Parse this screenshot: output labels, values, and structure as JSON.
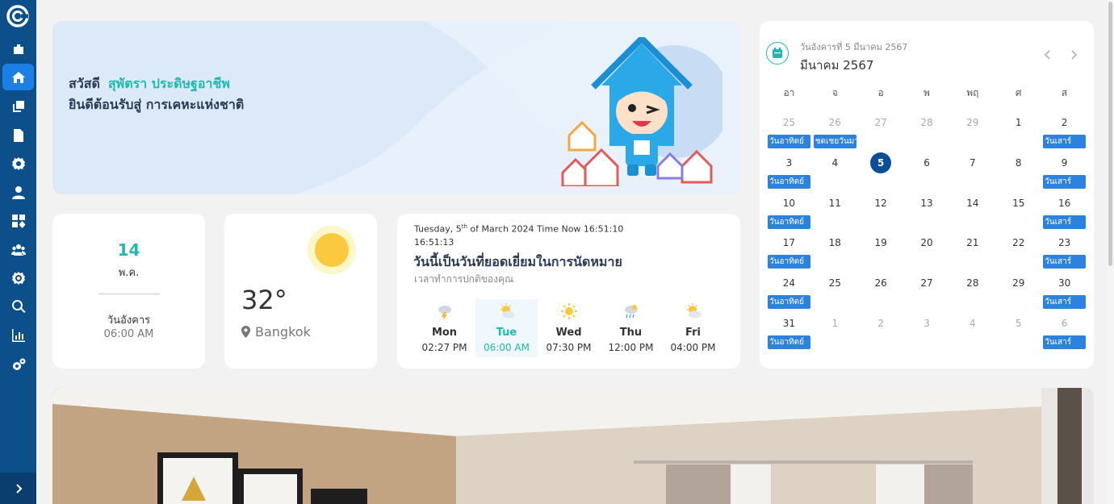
{
  "sidebar": {
    "items": [
      {
        "icon": "briefcase-icon"
      },
      {
        "icon": "home-icon"
      },
      {
        "icon": "copy-icon"
      },
      {
        "icon": "document-icon"
      },
      {
        "icon": "gear-icon"
      },
      {
        "icon": "user-icon"
      },
      {
        "icon": "apps-icon"
      },
      {
        "icon": "users-group-icon"
      },
      {
        "icon": "settings-cog-icon"
      },
      {
        "icon": "search-icon"
      },
      {
        "icon": "bar-chart-icon"
      },
      {
        "icon": "gears-icon"
      }
    ],
    "active_index": 1,
    "color": "#0d4f8b",
    "active_color": "#1b7fe3"
  },
  "banner": {
    "greeting": "สวัสดี",
    "user_name": "สุพัตรา ประดิษฐอาชีพ",
    "welcome": "ยินดีต้อนรับสู่ การเคหะแห่งชาติ"
  },
  "date_card": {
    "day": "14",
    "month": "พ.ค.",
    "weekday": "วันอังคาร",
    "time": "06:00 AM"
  },
  "weather": {
    "temperature": "32°",
    "city": "Bangkok"
  },
  "schedule": {
    "datetime_prefix": "Tuesday, 5",
    "datetime_suffix": "th",
    "datetime_rest": " of March 2024 Time Now 16:51:10",
    "time_line": "16:51:13",
    "title": "วันนี้เป็นวันที่ยอดเยี่ยมในการนัดหมาย",
    "subtitle": "เวลาทำการปกติของคุณ",
    "forecast": [
      {
        "day": "Mon",
        "time": "02:27 PM",
        "icon": "thunderstorm-icon"
      },
      {
        "day": "Tue",
        "time": "06:00 AM",
        "icon": "partly-sunny-icon",
        "active": true
      },
      {
        "day": "Wed",
        "time": "07:30 PM",
        "icon": "sunny-icon"
      },
      {
        "day": "Thu",
        "time": "12:00 PM",
        "icon": "rain-icon"
      },
      {
        "day": "Fri",
        "time": "04:00 PM",
        "icon": "partly-sunny-icon"
      }
    ]
  },
  "calendar": {
    "selected_date": "วันอังคารที่ 5 มีนาคม 2567",
    "month_label": "มีนาคม 2567",
    "weekdays": [
      "อา",
      "จ",
      "อ",
      "พ",
      "พฤ",
      "ศ",
      "ส"
    ],
    "weeks": [
      [
        {
          "d": "25",
          "m": true,
          "e": "วันอาทิตย์"
        },
        {
          "d": "26",
          "m": true,
          "e": "ชดเชยวันมาฆบูชา"
        },
        {
          "d": "27",
          "m": true
        },
        {
          "d": "28",
          "m": true
        },
        {
          "d": "29",
          "m": true
        },
        {
          "d": "1"
        },
        {
          "d": "2",
          "e": "วันเสาร์"
        }
      ],
      [
        {
          "d": "3",
          "e": "วันอาทิตย์"
        },
        {
          "d": "4"
        },
        {
          "d": "5",
          "t": true
        },
        {
          "d": "6"
        },
        {
          "d": "7"
        },
        {
          "d": "8"
        },
        {
          "d": "9",
          "e": "วันเสาร์"
        }
      ],
      [
        {
          "d": "10",
          "e": "วันอาทิตย์"
        },
        {
          "d": "11"
        },
        {
          "d": "12"
        },
        {
          "d": "13"
        },
        {
          "d": "14"
        },
        {
          "d": "15"
        },
        {
          "d": "16",
          "e": "วันเสาร์"
        }
      ],
      [
        {
          "d": "17",
          "e": "วันอาทิตย์"
        },
        {
          "d": "18"
        },
        {
          "d": "19"
        },
        {
          "d": "20"
        },
        {
          "d": "21"
        },
        {
          "d": "22"
        },
        {
          "d": "23",
          "e": "วันเสาร์"
        }
      ],
      [
        {
          "d": "24",
          "e": "วันอาทิตย์"
        },
        {
          "d": "25"
        },
        {
          "d": "26"
        },
        {
          "d": "27"
        },
        {
          "d": "28"
        },
        {
          "d": "29"
        },
        {
          "d": "30",
          "e": "วันเสาร์"
        }
      ],
      [
        {
          "d": "31",
          "e": "วันอาทิตย์"
        },
        {
          "d": "1",
          "m": true
        },
        {
          "d": "2",
          "m": true
        },
        {
          "d": "3",
          "m": true
        },
        {
          "d": "4",
          "m": true
        },
        {
          "d": "5",
          "m": true
        },
        {
          "d": "6",
          "m": true,
          "e": "วันเสาร์"
        }
      ]
    ]
  },
  "colors": {
    "accent": "#1fb9b2",
    "event": "#2c82dd",
    "today": "#0b4e98"
  }
}
